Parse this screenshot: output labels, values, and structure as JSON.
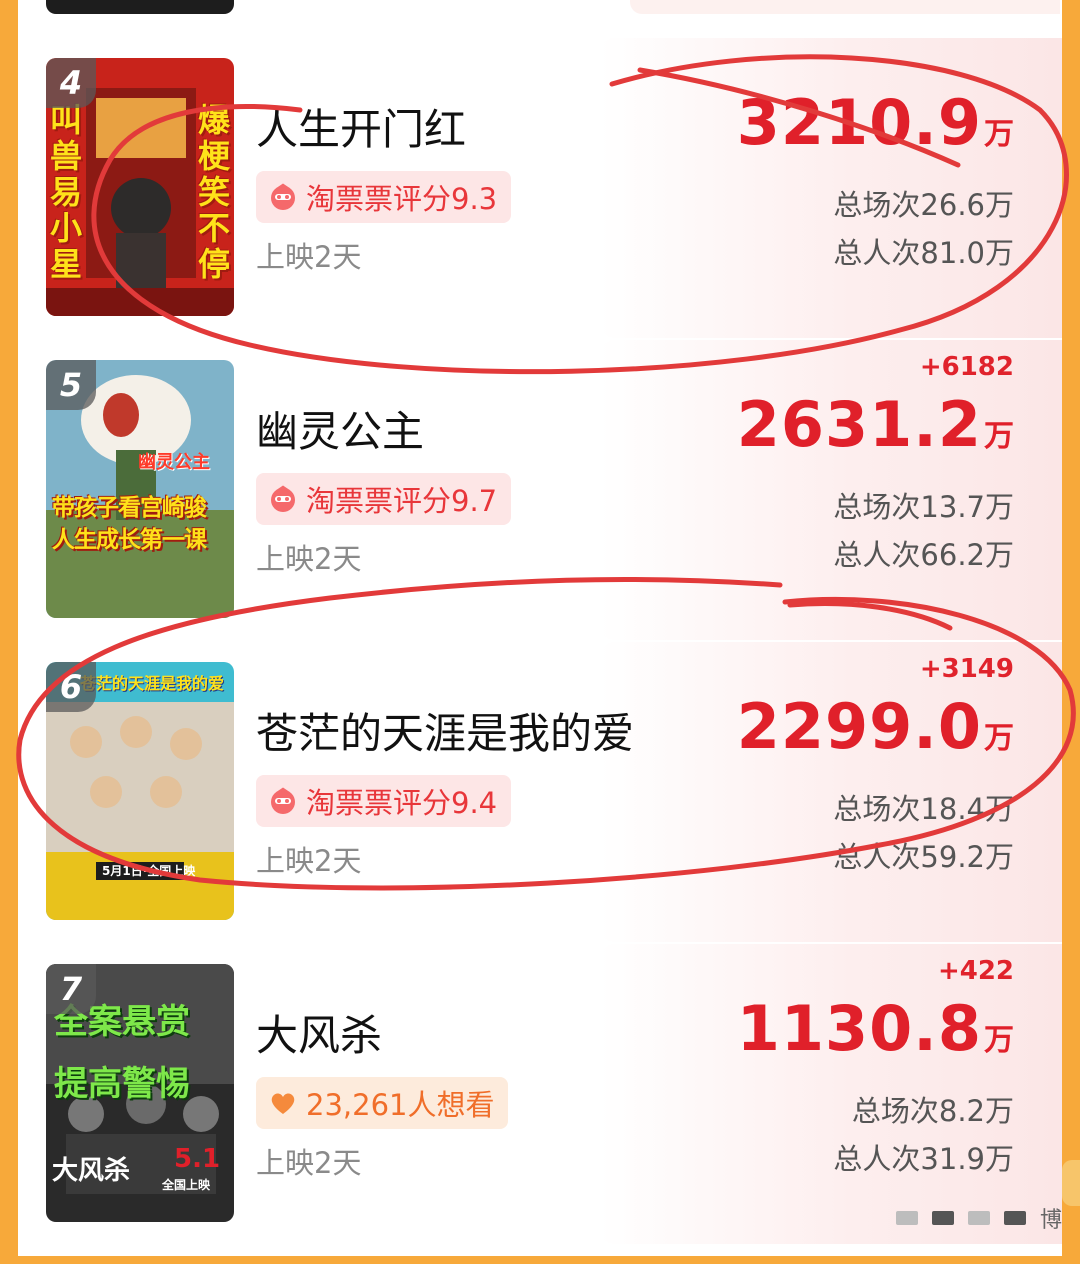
{
  "colors": {
    "accent_red": "#e0202a",
    "rating_chip_bg": "#fde6e6",
    "want_chip_bg": "#fdebdc",
    "page_bg": "#f7a93a"
  },
  "movies": [
    {
      "rank": "4",
      "title": "人生开门红",
      "rating_icon": "taopiaopiao-icon",
      "rating": "淘票票评分9.3",
      "days": "上映2天",
      "delta": "",
      "box_office": "3210.9",
      "unit": "万",
      "screenings": "总场次26.6万",
      "admissions": "总人次81.0万",
      "poster_text": [
        "叫兽易小星",
        "爆梗笑不停"
      ],
      "circled": true
    },
    {
      "rank": "5",
      "title": "幽灵公主",
      "rating_icon": "taopiaopiao-icon",
      "rating": "淘票票评分9.7",
      "days": "上映2天",
      "delta": "+6182",
      "box_office": "2631.2",
      "unit": "万",
      "screenings": "总场次13.7万",
      "admissions": "总人次66.2万",
      "poster_text": [
        "幽灵公主",
        "带孩子看宫崎骏",
        "人生成长第一课"
      ],
      "circled": false
    },
    {
      "rank": "6",
      "title": "苍茫的天涯是我的爱",
      "rating_icon": "taopiaopiao-icon",
      "rating": "淘票票评分9.4",
      "days": "上映2天",
      "delta": "+3149",
      "box_office": "2299.0",
      "unit": "万",
      "screenings": "总场次18.4万",
      "admissions": "总人次59.2万",
      "poster_text": [
        "苍茫的天涯是我的爱",
        "5月1日·全国上映"
      ],
      "circled": true
    },
    {
      "rank": "7",
      "title": "大风杀",
      "rating_icon": "heart-icon",
      "rating": "23,261人想看",
      "days": "上映2天",
      "delta": "+422",
      "box_office": "1130.8",
      "unit": "万",
      "screenings": "总场次8.2万",
      "admissions": "总人次31.9万",
      "poster_text": [
        "全案悬赏",
        "提高警惕",
        "大风杀",
        "5.1",
        "全国上映"
      ],
      "circled": false
    }
  ],
  "watermark": "博"
}
